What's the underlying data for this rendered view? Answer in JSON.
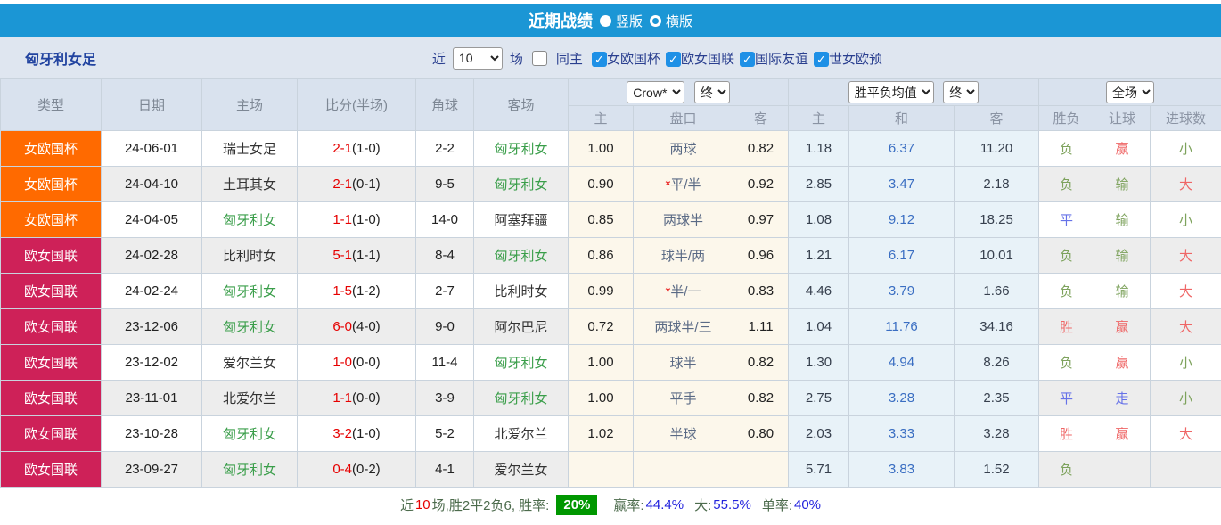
{
  "title_bar": {
    "title": "近期战绩",
    "vertical_label": "竖版",
    "horizontal_label": "横版"
  },
  "filter_bar": {
    "team": "匈牙利女足",
    "near_label": "近",
    "near_value": "10",
    "games_label": "场",
    "same_home_label": "同主",
    "leagues": [
      {
        "label": "女欧国杯",
        "checked": true
      },
      {
        "label": "欧女国联",
        "checked": true
      },
      {
        "label": "国际友谊",
        "checked": true
      },
      {
        "label": "世女欧预",
        "checked": true
      }
    ]
  },
  "table": {
    "headers_left": [
      "类型",
      "日期",
      "主场",
      "比分(半场)",
      "角球",
      "客场"
    ],
    "odds_group": {
      "company_select": "Crow*",
      "time_select": "终",
      "sub": [
        "主",
        "盘口",
        "客"
      ]
    },
    "avg_group": {
      "type_select": "胜平负均值",
      "time_select": "终",
      "sub": [
        "主",
        "和",
        "客"
      ]
    },
    "result_group": {
      "scope_select": "全场",
      "sub": [
        "胜负",
        "让球",
        "进球数"
      ]
    },
    "rows": [
      {
        "type": "女欧国杯",
        "type_c": "orange",
        "date": "24-06-01",
        "home": "瑞士女足",
        "home_c": "d",
        "ft": "2-1",
        "ht": "(1-0)",
        "corner": "2-2",
        "away": "匈牙利女",
        "away_c": "g",
        "oh": "1.00",
        "hc": "两球",
        "hc_star": false,
        "oa": "0.82",
        "ah": "1.18",
        "ad": "6.37",
        "aa": "11.20",
        "res": "负",
        "res_c": "g",
        "let": "赢",
        "let_c": "r",
        "goal": "小",
        "goal_c": "g"
      },
      {
        "type": "女欧国杯",
        "type_c": "orange",
        "date": "24-04-10",
        "home": "土耳其女",
        "home_c": "d",
        "ft": "2-1",
        "ht": "(0-1)",
        "corner": "9-5",
        "away": "匈牙利女",
        "away_c": "g",
        "oh": "0.90",
        "hc": "平/半",
        "hc_star": true,
        "oa": "0.92",
        "ah": "2.85",
        "ad": "3.47",
        "aa": "2.18",
        "res": "负",
        "res_c": "g",
        "let": "输",
        "let_c": "g",
        "goal": "大",
        "goal_c": "r"
      },
      {
        "type": "女欧国杯",
        "type_c": "orange",
        "date": "24-04-05",
        "home": "匈牙利女",
        "home_c": "g",
        "ft": "1-1",
        "ht": "(1-0)",
        "corner": "14-0",
        "away": "阿塞拜疆",
        "away_c": "d",
        "oh": "0.85",
        "hc": "两球半",
        "hc_star": false,
        "oa": "0.97",
        "ah": "1.08",
        "ad": "9.12",
        "aa": "18.25",
        "res": "平",
        "res_c": "b",
        "let": "输",
        "let_c": "g",
        "goal": "小",
        "goal_c": "g"
      },
      {
        "type": "欧女国联",
        "type_c": "crimson",
        "date": "24-02-28",
        "home": "比利时女",
        "home_c": "d",
        "ft": "5-1",
        "ht": "(1-1)",
        "corner": "8-4",
        "away": "匈牙利女",
        "away_c": "g",
        "oh": "0.86",
        "hc": "球半/两",
        "hc_star": false,
        "oa": "0.96",
        "ah": "1.21",
        "ad": "6.17",
        "aa": "10.01",
        "res": "负",
        "res_c": "g",
        "let": "输",
        "let_c": "g",
        "goal": "大",
        "goal_c": "r"
      },
      {
        "type": "欧女国联",
        "type_c": "crimson",
        "date": "24-02-24",
        "home": "匈牙利女",
        "home_c": "g",
        "ft": "1-5",
        "ht": "(1-2)",
        "corner": "2-7",
        "away": "比利时女",
        "away_c": "d",
        "oh": "0.99",
        "hc": "半/一",
        "hc_star": true,
        "oa": "0.83",
        "ah": "4.46",
        "ad": "3.79",
        "aa": "1.66",
        "res": "负",
        "res_c": "g",
        "let": "输",
        "let_c": "g",
        "goal": "大",
        "goal_c": "r"
      },
      {
        "type": "欧女国联",
        "type_c": "crimson",
        "date": "23-12-06",
        "home": "匈牙利女",
        "home_c": "g",
        "ft": "6-0",
        "ht": "(4-0)",
        "corner": "9-0",
        "away": "阿尔巴尼",
        "away_c": "d",
        "oh": "0.72",
        "hc": "两球半/三",
        "hc_star": false,
        "oa": "1.11",
        "ah": "1.04",
        "ad": "11.76",
        "aa": "34.16",
        "res": "胜",
        "res_c": "r",
        "let": "赢",
        "let_c": "r",
        "goal": "大",
        "goal_c": "r"
      },
      {
        "type": "欧女国联",
        "type_c": "crimson",
        "date": "23-12-02",
        "home": "爱尔兰女",
        "home_c": "d",
        "ft": "1-0",
        "ht": "(0-0)",
        "corner": "11-4",
        "away": "匈牙利女",
        "away_c": "g",
        "oh": "1.00",
        "hc": "球半",
        "hc_star": false,
        "oa": "0.82",
        "ah": "1.30",
        "ad": "4.94",
        "aa": "8.26",
        "res": "负",
        "res_c": "g",
        "let": "赢",
        "let_c": "r",
        "goal": "小",
        "goal_c": "g"
      },
      {
        "type": "欧女国联",
        "type_c": "crimson",
        "date": "23-11-01",
        "home": "北爱尔兰",
        "home_c": "d",
        "ft": "1-1",
        "ht": "(0-0)",
        "corner": "3-9",
        "away": "匈牙利女",
        "away_c": "g",
        "oh": "1.00",
        "hc": "平手",
        "hc_star": false,
        "oa": "0.82",
        "ah": "2.75",
        "ad": "3.28",
        "aa": "2.35",
        "res": "平",
        "res_c": "b",
        "let": "走",
        "let_c": "b",
        "goal": "小",
        "goal_c": "g"
      },
      {
        "type": "欧女国联",
        "type_c": "crimson",
        "date": "23-10-28",
        "home": "匈牙利女",
        "home_c": "g",
        "ft": "3-2",
        "ht": "(1-0)",
        "corner": "5-2",
        "away": "北爱尔兰",
        "away_c": "d",
        "oh": "1.02",
        "hc": "半球",
        "hc_star": false,
        "oa": "0.80",
        "ah": "2.03",
        "ad": "3.33",
        "aa": "3.28",
        "res": "胜",
        "res_c": "r",
        "let": "赢",
        "let_c": "r",
        "goal": "大",
        "goal_c": "r"
      },
      {
        "type": "欧女国联",
        "type_c": "crimson",
        "date": "23-09-27",
        "home": "匈牙利女",
        "home_c": "g",
        "ft": "0-4",
        "ht": "(0-2)",
        "corner": "4-1",
        "away": "爱尔兰女",
        "away_c": "d",
        "oh": "",
        "hc": "",
        "hc_star": false,
        "oa": "",
        "ah": "5.71",
        "ad": "3.83",
        "aa": "1.52",
        "res": "负",
        "res_c": "g",
        "let": "",
        "let_c": "",
        "goal": "",
        "goal_c": ""
      }
    ]
  },
  "footer": {
    "near": "近",
    "count": "10",
    "summary": "场,胜2平2负6, 胜率:",
    "win_rate": "20%",
    "rate2_label": "赢率:",
    "rate2": "44.4%",
    "rate3_label": "大:",
    "rate3": "55.5%",
    "rate4_label": "单率:",
    "rate4": "40%"
  },
  "colors": {
    "accent_blue": "#1b96d5",
    "badge_orange": "#ff6a00",
    "badge_crimson": "#ce2158",
    "team_green": "#3a9e4a",
    "result_green": "#7da25c",
    "result_red": "#ef6666",
    "result_blue": "#6672e8",
    "score_red": "#e60000",
    "draw_avg_blue": "#3a6ec2",
    "win_rate_bg": "#009700",
    "footer_value_blue": "#2222dd"
  }
}
